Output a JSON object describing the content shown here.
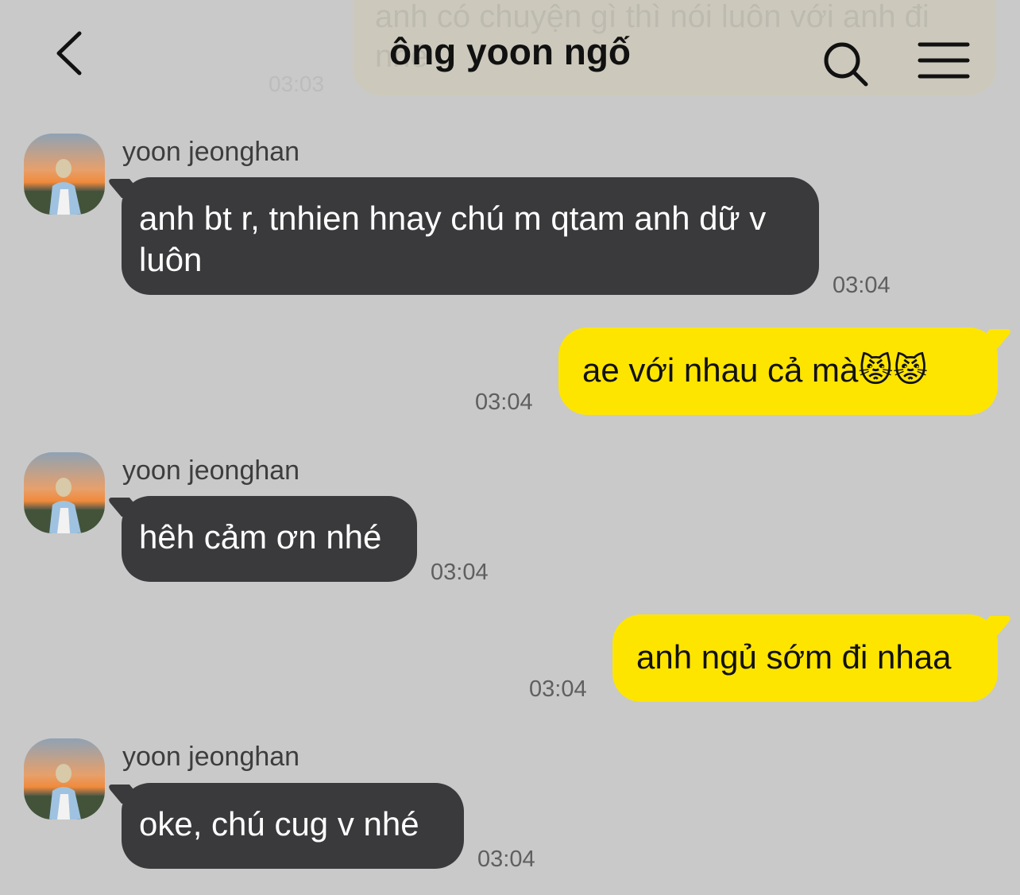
{
  "header": {
    "title": "ông yoon ngố",
    "back_icon": "chevron-left-icon",
    "search_icon": "search-icon",
    "menu_icon": "hamburger-menu-icon"
  },
  "previous_message": {
    "text": "anh có chuyện gì thì nói luôn với anh đi nhé",
    "time": "03:03"
  },
  "colors": {
    "background": "#c9c9c9",
    "incoming_bubble": "#3a3a3c",
    "outgoing_bubble": "#fee500"
  },
  "messages": [
    {
      "direction": "in",
      "sender": "yoon jeonghan",
      "text": "anh bt r, tnhien hnay chú m qtam anh dữ v luôn",
      "time": "03:04"
    },
    {
      "direction": "out",
      "text": "ae với nhau cả mà😾😾",
      "time": "03:04"
    },
    {
      "direction": "in",
      "sender": "yoon jeonghan",
      "text": "hêh cảm ơn nhé",
      "time": "03:04"
    },
    {
      "direction": "out",
      "text": "anh ngủ sớm đi nhaa",
      "time": "03:04"
    },
    {
      "direction": "in",
      "sender": "yoon jeonghan",
      "text": "oke, chú cug v nhé",
      "time": "03:04"
    }
  ]
}
